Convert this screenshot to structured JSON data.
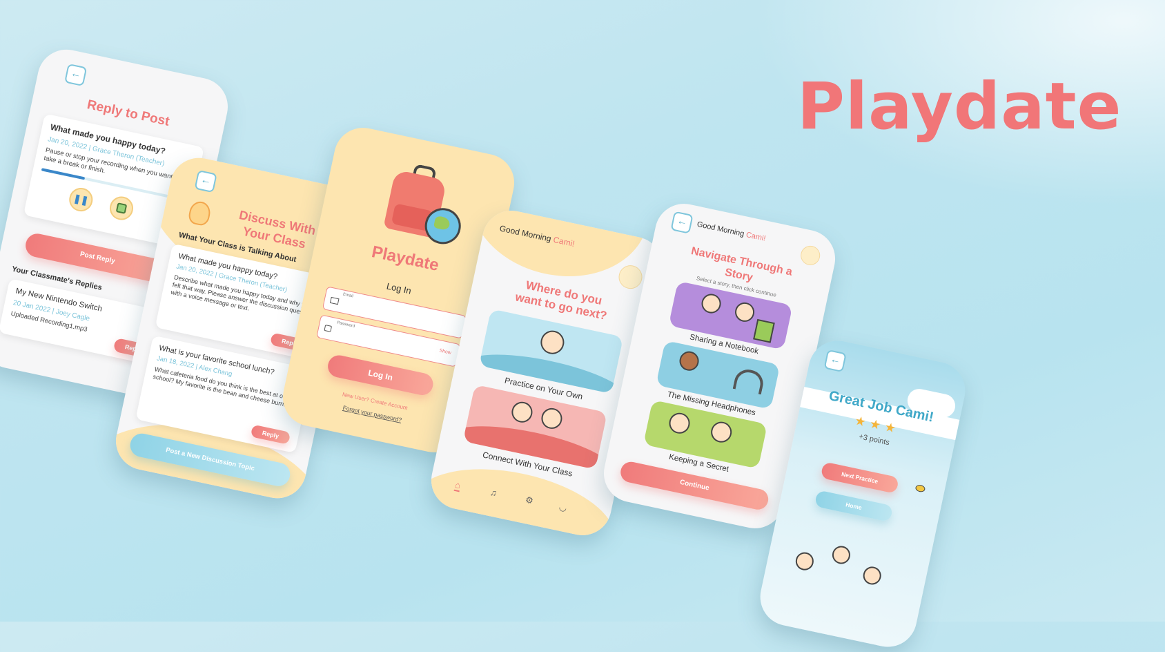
{
  "brand_title": "Playdate",
  "colors": {
    "coral": "#ef7878",
    "blue": "#7fc6dc",
    "yellow": "#fde5b0",
    "background": "#c3e7f1"
  },
  "screen_reply": {
    "back_icon": "arrow-left-icon",
    "title": "Reply to Post",
    "question": "What made you happy today?",
    "date": "Jan 20, 2022",
    "author": "Grace Theron (Teacher)",
    "instructions": "Pause or stop your recording when you want to take a break or finish.",
    "recording_progress": 0.3,
    "pause_icon": "pause-icon",
    "stop_icon": "stop-icon",
    "post_button": "Post Reply",
    "replies_title": "Your Classmate's Replies",
    "reply_card": {
      "title": "My New Nintendo Switch",
      "date": "20 Jan 2022",
      "author": "Joey Cagle",
      "file": "Uploaded Recording1.mp3",
      "button": "Reply"
    }
  },
  "screen_discuss": {
    "back_icon": "arrow-left-icon",
    "bulb_icon": "lightbulb-icon",
    "title_line1": "Discuss With",
    "title_line2": "Your Class",
    "subtitle": "What Your Class is Talking About",
    "posts": [
      {
        "title": "What made you happy today?",
        "date": "Jan 20, 2022",
        "author": "Grace Theron (Teacher)",
        "body": "Describe what made you happy today and why you felt that way. Please answer the discussion question with a voice message or text.",
        "button": "Reply"
      },
      {
        "title": "What is your favorite school lunch?",
        "date": "Jan 18, 2022",
        "author": "Alex Chang",
        "body": "What cafeteria food do you think is the best at our school? My favorite is the bean and cheese burrito.",
        "button": "Reply"
      }
    ],
    "new_topic_button": "Post a New Discussion Topic"
  },
  "screen_login": {
    "app_name": "Playdate",
    "heading": "Log In",
    "email_label": "Email",
    "password_label": "Password",
    "show_label": "Show",
    "login_button": "Log In",
    "new_user_link": "New User? Create Account",
    "forgot_link": "Forgot your password?"
  },
  "screen_home": {
    "greeting": "Good Morning",
    "name": "Cami!",
    "question_line1": "Where do you",
    "question_line2": "want to go next?",
    "options": [
      "Practice on Your Own",
      "Connect With Your Class"
    ],
    "nav_icons": [
      "home-icon",
      "bell-icon",
      "gear-icon",
      "profile-icon"
    ]
  },
  "screen_story": {
    "greeting": "Good Morning",
    "name": "Cami!",
    "title_line1": "Navigate Through a",
    "title_line2": "Story",
    "subtitle": "Select a story, then click continue",
    "stories": [
      "Sharing a Notebook",
      "The Missing Headphones",
      "Keeping a Secret"
    ],
    "continue_button": "Continue"
  },
  "screen_great": {
    "title": "Great Job Cami!",
    "stars": 3,
    "points": "+3 points",
    "next_button": "Next Practice",
    "home_button": "Home"
  }
}
